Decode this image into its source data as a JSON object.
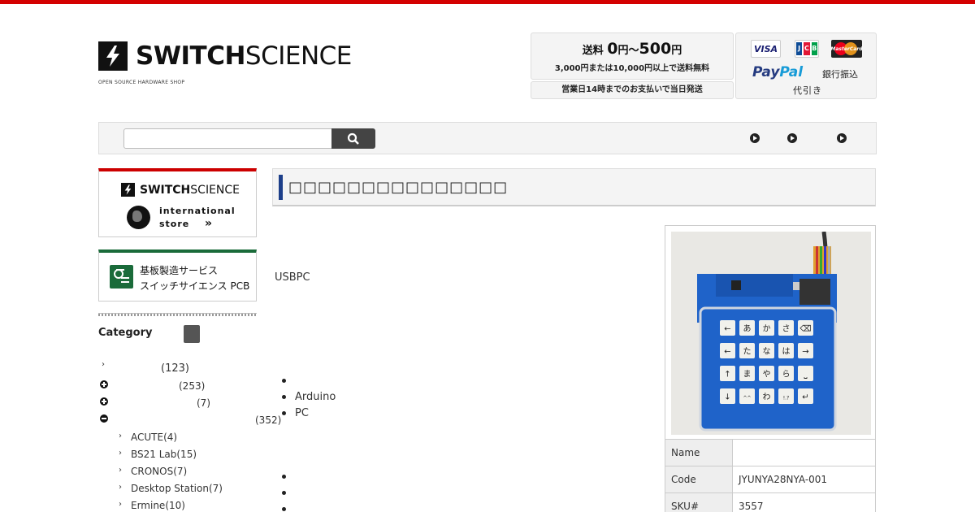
{
  "header": {
    "brand_bold": "SWITCH",
    "brand_light": "SCIENCE",
    "tagline": "OPEN SOURCE HARDWARE SHOP",
    "shipping": {
      "prefix": "送料",
      "low": "0",
      "yen1": "円～",
      "high": "500",
      "yen2": "円",
      "line2": "3,000円または10,000円以上で送料無料",
      "same_day": "営業日14時までのお支払いで当日発送"
    },
    "payment": {
      "visa": "VISA",
      "jcb": [
        "J",
        "C",
        "B"
      ],
      "mastercard": "MasterCard",
      "paypal_1": "Pay",
      "paypal_2": "Pal",
      "bank": "銀行振込",
      "cod": "代引き"
    }
  },
  "search": {
    "placeholder": ""
  },
  "sidebar": {
    "intl_banner": {
      "brand_bold": "SWITCH",
      "brand_light": "SCIENCE",
      "line1": "international",
      "line2": "store",
      "arrow": "»"
    },
    "pcb_banner": {
      "line1": "基板製造サービス",
      "line2": "スイッチサイエンス PCB"
    },
    "category_heading": "Category",
    "categories": [
      {
        "count": "(123)"
      },
      {
        "count": "(253)"
      },
      {
        "count": "(7)"
      },
      {
        "count": "(352)"
      }
    ],
    "subcategories": [
      {
        "label": "ACUTE(4)"
      },
      {
        "label": "BS21 Lab(15)"
      },
      {
        "label": "CRONOS(7)"
      },
      {
        "label": "Desktop Station(7)"
      },
      {
        "label": "Ermine(10)"
      }
    ]
  },
  "product": {
    "title": "□□□□□□□□□□□□□□□",
    "desc_1": "USBPC",
    "list_items": [
      "Arduino",
      "PC"
    ],
    "photo_keys": [
      [
        "←",
        "あ",
        "か",
        "さ",
        "⌫"
      ],
      [
        "←",
        "た",
        "な",
        "は",
        "→"
      ],
      [
        "↑",
        "ま",
        "や",
        "ら",
        "⎵"
      ],
      [
        "↓",
        "^^",
        "わ",
        "!.?",
        "↵"
      ]
    ],
    "specs": [
      {
        "key": "Name",
        "value": ""
      },
      {
        "key": "Code",
        "value": "JYUNYA28NYA-001"
      },
      {
        "key": "SKU#",
        "value": "3557"
      }
    ]
  },
  "colors": {
    "accent_red": "#d40000",
    "title_accent": "#1d3f8a",
    "pcb_green": "#1a6b3a"
  }
}
